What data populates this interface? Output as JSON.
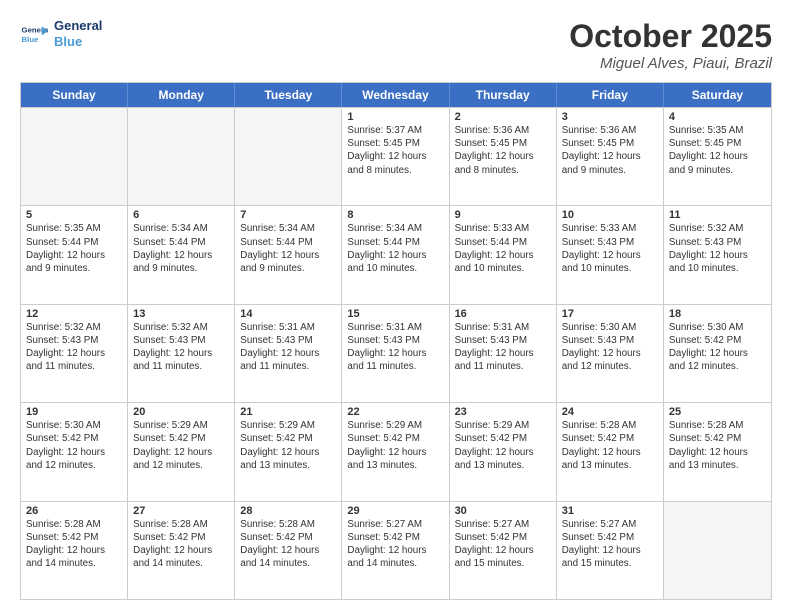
{
  "header": {
    "logo_general": "General",
    "logo_blue": "Blue",
    "month_title": "October 2025",
    "location": "Miguel Alves, Piaui, Brazil"
  },
  "weekdays": [
    "Sunday",
    "Monday",
    "Tuesday",
    "Wednesday",
    "Thursday",
    "Friday",
    "Saturday"
  ],
  "rows": [
    [
      {
        "day": "",
        "text": ""
      },
      {
        "day": "",
        "text": ""
      },
      {
        "day": "",
        "text": ""
      },
      {
        "day": "1",
        "text": "Sunrise: 5:37 AM\nSunset: 5:45 PM\nDaylight: 12 hours and 8 minutes."
      },
      {
        "day": "2",
        "text": "Sunrise: 5:36 AM\nSunset: 5:45 PM\nDaylight: 12 hours and 8 minutes."
      },
      {
        "day": "3",
        "text": "Sunrise: 5:36 AM\nSunset: 5:45 PM\nDaylight: 12 hours and 9 minutes."
      },
      {
        "day": "4",
        "text": "Sunrise: 5:35 AM\nSunset: 5:45 PM\nDaylight: 12 hours and 9 minutes."
      }
    ],
    [
      {
        "day": "5",
        "text": "Sunrise: 5:35 AM\nSunset: 5:44 PM\nDaylight: 12 hours and 9 minutes."
      },
      {
        "day": "6",
        "text": "Sunrise: 5:34 AM\nSunset: 5:44 PM\nDaylight: 12 hours and 9 minutes."
      },
      {
        "day": "7",
        "text": "Sunrise: 5:34 AM\nSunset: 5:44 PM\nDaylight: 12 hours and 9 minutes."
      },
      {
        "day": "8",
        "text": "Sunrise: 5:34 AM\nSunset: 5:44 PM\nDaylight: 12 hours and 10 minutes."
      },
      {
        "day": "9",
        "text": "Sunrise: 5:33 AM\nSunset: 5:44 PM\nDaylight: 12 hours and 10 minutes."
      },
      {
        "day": "10",
        "text": "Sunrise: 5:33 AM\nSunset: 5:43 PM\nDaylight: 12 hours and 10 minutes."
      },
      {
        "day": "11",
        "text": "Sunrise: 5:32 AM\nSunset: 5:43 PM\nDaylight: 12 hours and 10 minutes."
      }
    ],
    [
      {
        "day": "12",
        "text": "Sunrise: 5:32 AM\nSunset: 5:43 PM\nDaylight: 12 hours and 11 minutes."
      },
      {
        "day": "13",
        "text": "Sunrise: 5:32 AM\nSunset: 5:43 PM\nDaylight: 12 hours and 11 minutes."
      },
      {
        "day": "14",
        "text": "Sunrise: 5:31 AM\nSunset: 5:43 PM\nDaylight: 12 hours and 11 minutes."
      },
      {
        "day": "15",
        "text": "Sunrise: 5:31 AM\nSunset: 5:43 PM\nDaylight: 12 hours and 11 minutes."
      },
      {
        "day": "16",
        "text": "Sunrise: 5:31 AM\nSunset: 5:43 PM\nDaylight: 12 hours and 11 minutes."
      },
      {
        "day": "17",
        "text": "Sunrise: 5:30 AM\nSunset: 5:43 PM\nDaylight: 12 hours and 12 minutes."
      },
      {
        "day": "18",
        "text": "Sunrise: 5:30 AM\nSunset: 5:42 PM\nDaylight: 12 hours and 12 minutes."
      }
    ],
    [
      {
        "day": "19",
        "text": "Sunrise: 5:30 AM\nSunset: 5:42 PM\nDaylight: 12 hours and 12 minutes."
      },
      {
        "day": "20",
        "text": "Sunrise: 5:29 AM\nSunset: 5:42 PM\nDaylight: 12 hours and 12 minutes."
      },
      {
        "day": "21",
        "text": "Sunrise: 5:29 AM\nSunset: 5:42 PM\nDaylight: 12 hours and 13 minutes."
      },
      {
        "day": "22",
        "text": "Sunrise: 5:29 AM\nSunset: 5:42 PM\nDaylight: 12 hours and 13 minutes."
      },
      {
        "day": "23",
        "text": "Sunrise: 5:29 AM\nSunset: 5:42 PM\nDaylight: 12 hours and 13 minutes."
      },
      {
        "day": "24",
        "text": "Sunrise: 5:28 AM\nSunset: 5:42 PM\nDaylight: 12 hours and 13 minutes."
      },
      {
        "day": "25",
        "text": "Sunrise: 5:28 AM\nSunset: 5:42 PM\nDaylight: 12 hours and 13 minutes."
      }
    ],
    [
      {
        "day": "26",
        "text": "Sunrise: 5:28 AM\nSunset: 5:42 PM\nDaylight: 12 hours and 14 minutes."
      },
      {
        "day": "27",
        "text": "Sunrise: 5:28 AM\nSunset: 5:42 PM\nDaylight: 12 hours and 14 minutes."
      },
      {
        "day": "28",
        "text": "Sunrise: 5:28 AM\nSunset: 5:42 PM\nDaylight: 12 hours and 14 minutes."
      },
      {
        "day": "29",
        "text": "Sunrise: 5:27 AM\nSunset: 5:42 PM\nDaylight: 12 hours and 14 minutes."
      },
      {
        "day": "30",
        "text": "Sunrise: 5:27 AM\nSunset: 5:42 PM\nDaylight: 12 hours and 15 minutes."
      },
      {
        "day": "31",
        "text": "Sunrise: 5:27 AM\nSunset: 5:42 PM\nDaylight: 12 hours and 15 minutes."
      },
      {
        "day": "",
        "text": ""
      }
    ]
  ]
}
